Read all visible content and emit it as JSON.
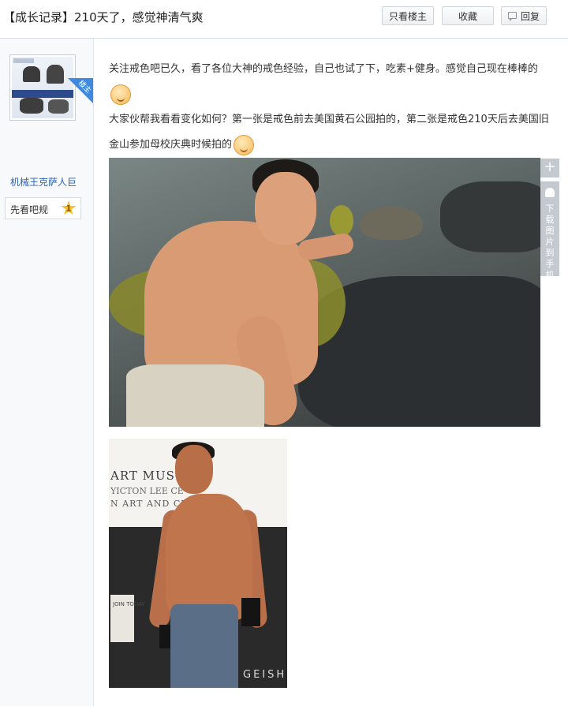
{
  "header": {
    "title": "【成长记录】210天了，感觉神清气爽",
    "buttons": {
      "only_op": "只看楼主",
      "favorite": "收藏",
      "reply": "回复"
    }
  },
  "author": {
    "op_tag": "楼主",
    "username": "机械王克萨人巨",
    "badge_label": "先看吧规",
    "badge_level": "1"
  },
  "post": {
    "line1": "关注戒色吧已久，看了各位大神的戒色经验，自己也试了下，吃素+健身。感觉自己现在棒棒的",
    "line2": "大家伙帮我看看变化如何？第一张是戒色前去美国黄石公园拍的，第二张是戒色210天后去美国旧金山参加母校庆典时候拍的"
  },
  "photo2": {
    "sign_main": "ART MUS",
    "sign_sub": "YICTON LEE CE",
    "sign_sub2": "N ART AND CU",
    "join_sign": "JOIN TODAY",
    "bottom_text": "GEISH"
  },
  "side_tools": {
    "plus": "+",
    "download_label": "下载图片到手机"
  },
  "colors": {
    "link_blue": "#2d64b3",
    "op_tag_blue": "#3f8ae0",
    "badge_gold": "#f5c02a"
  }
}
